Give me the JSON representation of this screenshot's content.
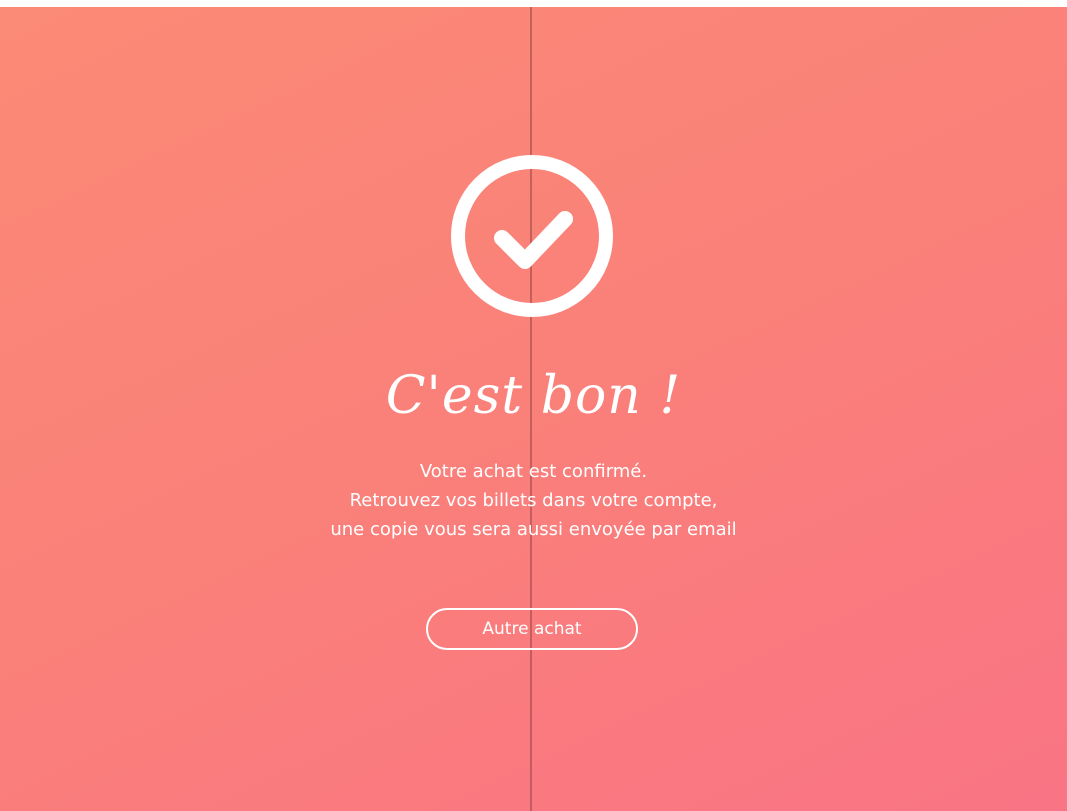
{
  "icon": {
    "name": "checkmark-circle-icon",
    "color": "#ffffff"
  },
  "confirmation": {
    "title": "C'est bon !",
    "lines": [
      "Votre achat est confirmé.",
      "Retrouvez vos billets dans votre compte,",
      "une copie vous sera aussi envoyée par email"
    ]
  },
  "actions": {
    "another_purchase": "Autre achat"
  },
  "colors": {
    "gradient_start": "#fb8a76",
    "gradient_end": "#f97484",
    "text": "#ffffff"
  }
}
